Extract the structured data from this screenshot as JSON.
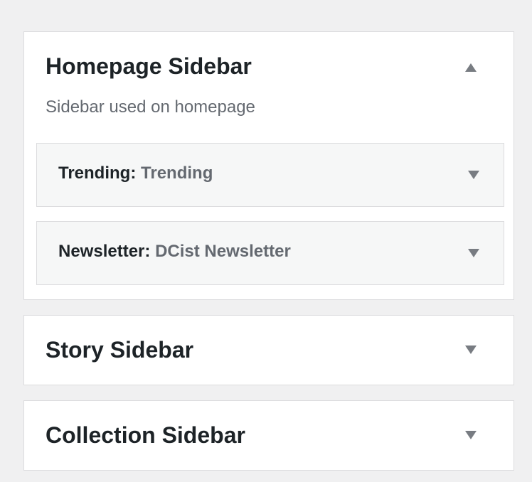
{
  "sidebars": [
    {
      "title": "Homepage Sidebar",
      "description": "Sidebar used on homepage",
      "expanded": true,
      "widgets": [
        {
          "name": "Trending",
          "separator": ":",
          "instance_title": "Trending"
        },
        {
          "name": "Newsletter",
          "separator": ":",
          "instance_title": "DCist Newsletter"
        }
      ]
    },
    {
      "title": "Story Sidebar",
      "expanded": false
    },
    {
      "title": "Collection Sidebar",
      "expanded": false
    }
  ],
  "icons": {
    "expanded": "arrow-up-icon",
    "collapsed": "arrow-down-icon"
  },
  "colors": {
    "background": "#f0f0f1",
    "panel": "#ffffff",
    "widget": "#f6f7f7",
    "border": "#dcdcde",
    "title_text": "#1d2327",
    "muted_text": "#646970",
    "arrow": "#787c82"
  }
}
